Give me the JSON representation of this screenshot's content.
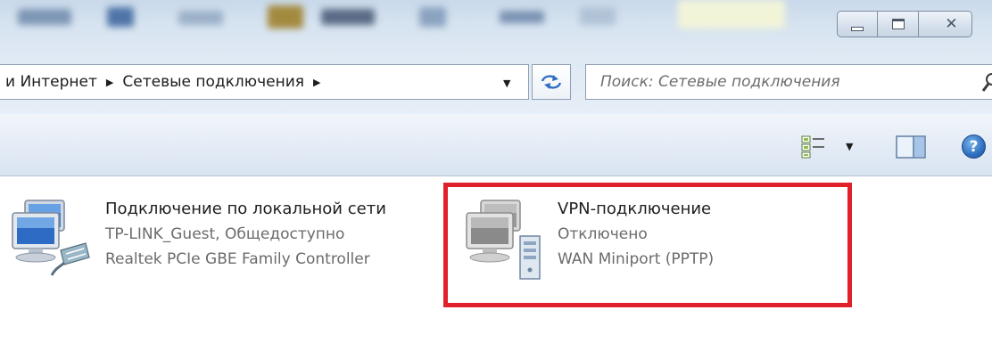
{
  "window": {
    "controls": {
      "minimize": "minimize",
      "maximize": "maximize",
      "close": "close"
    }
  },
  "address_bar": {
    "breadcrumbs": [
      "и Интернет",
      "Сетевые подключения"
    ],
    "separator_icon": "chevron-right-icon",
    "dropdown_icon": "chevron-down-icon",
    "refresh_icon": "refresh-icon"
  },
  "search": {
    "placeholder": "Поиск: Сетевые подключения",
    "icon": "search-icon"
  },
  "toolbar": {
    "buttons": [
      "views-icon",
      "chevron-down-icon",
      "preview-pane-icon",
      "help-icon"
    ],
    "help_glyph": "?"
  },
  "connections": [
    {
      "name": "Подключение по локальной сети",
      "status": "TP-LINK_Guest, Общедоступно",
      "device": "Realtek PCIe GBE Family Controller",
      "icon": "lan-connection-icon"
    },
    {
      "name": "VPN-подключение",
      "status": "Отключено",
      "device": "WAN Miniport (PPTP)",
      "icon": "vpn-connection-icon",
      "highlighted": true
    }
  ],
  "colors": {
    "highlight": "#e0212c",
    "link_blue": "#2f6fbf",
    "text_gray": "#6b6b6b"
  }
}
